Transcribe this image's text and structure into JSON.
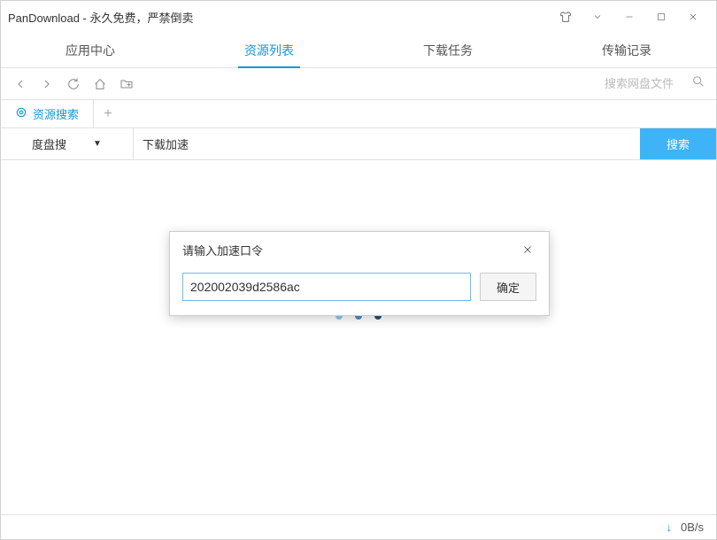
{
  "window": {
    "title": "PanDownload - 永久免费，严禁倒卖"
  },
  "tabs": {
    "items": [
      {
        "label": "应用中心"
      },
      {
        "label": "资源列表"
      },
      {
        "label": "下载任务"
      },
      {
        "label": "传输记录"
      }
    ],
    "active_index": 1
  },
  "toolbar": {
    "search_placeholder": "搜索网盘文件"
  },
  "subtabs": {
    "items": [
      {
        "label": "资源搜索",
        "icon": "target-icon"
      }
    ]
  },
  "search": {
    "engine": "度盘搜",
    "keyword_value": "下载加速",
    "button_label": "搜索"
  },
  "dialog": {
    "title": "请输入加速口令",
    "input_value": "202002039d2586ac",
    "confirm_label": "确定"
  },
  "statusbar": {
    "speed": "0B/s"
  },
  "colors": {
    "accent": "#1296db",
    "search_btn": "#3eb3f7"
  }
}
